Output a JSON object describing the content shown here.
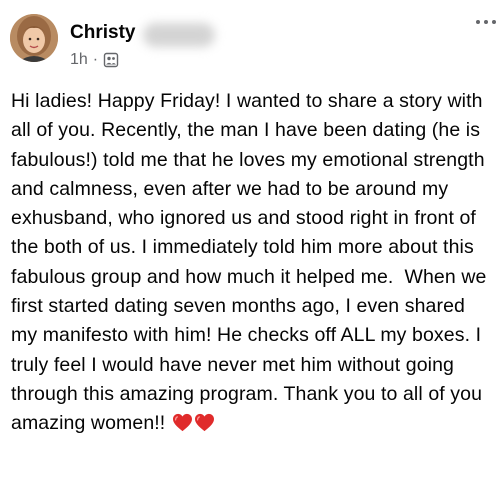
{
  "post": {
    "author_first_name": "Christy",
    "timestamp": "1h",
    "separator": "·",
    "audience_icon": "group-members-icon",
    "more_icon": "more-options-icon",
    "text": "Hi ladies! Happy Friday! I wanted to share a story with all of you. Recently, the man I have been dating (he is fabulous!) told me that he loves my emotional strength and calmness, even after we had to be around my exhusband, who ignored us and stood right in front of the both of us. I immediately told him more about this fabulous group and how much it helped me.  When we first started dating seven months ago, I even shared my manifesto with him! He checks off ALL my boxes. I truly feel I would have never met him without going through this amazing program. Thank you to all of you amazing women!!",
    "emoji": [
      "red-heart-emoji",
      "red-heart-emoji"
    ]
  },
  "colors": {
    "text": "#050505",
    "secondary_text": "#65676b",
    "heart": "#e02b2b",
    "background": "#ffffff"
  }
}
